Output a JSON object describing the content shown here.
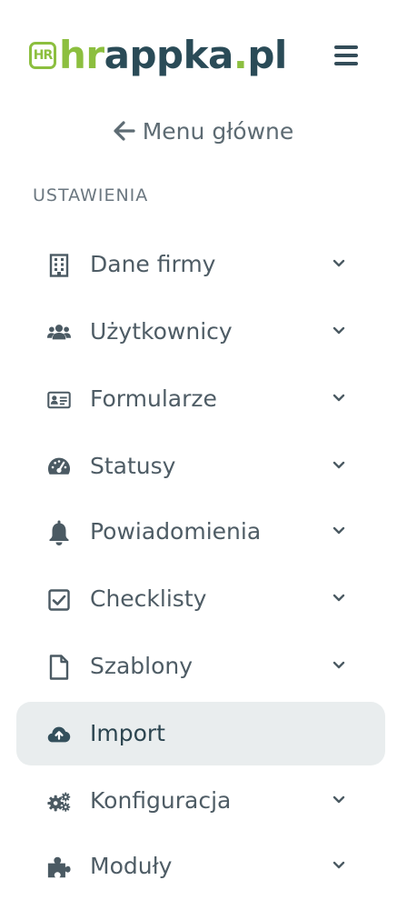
{
  "logo": {
    "badge": "HR",
    "hr": "hr",
    "main": "appka",
    "dot": ".",
    "pl": "pl",
    "colors": {
      "green": "#8cbf3f",
      "navy": "#2a4b57"
    }
  },
  "header": {
    "menu_icon": "hamburger-icon"
  },
  "back": {
    "label": "Menu główne",
    "icon": "arrow-left-icon"
  },
  "section": {
    "label": "USTAWIENIA"
  },
  "menu": {
    "items": [
      {
        "label": "Dane firmy",
        "icon": "building-icon",
        "expandable": true,
        "active": false
      },
      {
        "label": "Użytkownicy",
        "icon": "users-icon",
        "expandable": true,
        "active": false
      },
      {
        "label": "Formularze",
        "icon": "id-card-icon",
        "expandable": true,
        "active": false
      },
      {
        "label": "Statusy",
        "icon": "gauge-icon",
        "expandable": true,
        "active": false
      },
      {
        "label": "Powiadomienia",
        "icon": "bell-icon",
        "expandable": true,
        "active": false
      },
      {
        "label": "Checklisty",
        "icon": "check-square-icon",
        "expandable": true,
        "active": false
      },
      {
        "label": "Szablony",
        "icon": "file-icon",
        "expandable": true,
        "active": false
      },
      {
        "label": "Import",
        "icon": "cloud-upload-icon",
        "expandable": false,
        "active": true
      },
      {
        "label": "Konfiguracja",
        "icon": "cogs-icon",
        "expandable": true,
        "active": false
      },
      {
        "label": "Moduły",
        "icon": "puzzle-icon",
        "expandable": true,
        "active": false
      }
    ]
  },
  "colors": {
    "active_bg": "#e9edee",
    "text": "#4e5c65",
    "icon": "#4b5a63"
  }
}
